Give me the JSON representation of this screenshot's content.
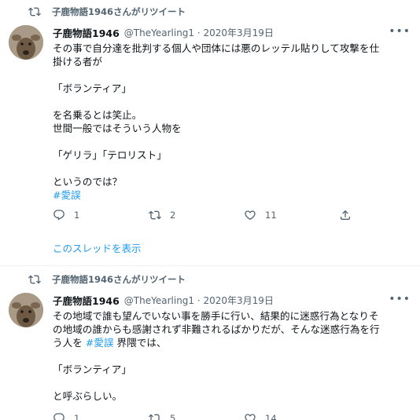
{
  "tweets": [
    {
      "retweet_label": "子鹿物語1946さんがリツイート",
      "author_name": "子鹿物語1946",
      "author_meta": "@TheYearling1 · 2020年3月19日",
      "more_label": "•••",
      "text_lines": [
        "その事で自分達を批判する個人や団体には悪のレッテル貼りして攻撃を仕",
        "掛ける者が",
        "",
        "「ボランティア」",
        "",
        "を名乗るとは笑止。",
        "世間一般ではそういう人物を",
        "",
        "「ゲリラ」「テロリスト」",
        "",
        "というのでは？"
      ],
      "hashtag": "#愛誤",
      "reply_count": "1",
      "retweet_count": "2",
      "like_count": "11",
      "show_thread": "このスレッドを表示"
    },
    {
      "retweet_label": "子鹿物語1946さんがリツイート",
      "author_name": "子鹿物語1946",
      "author_meta": "@TheYearling1 · 2020年3月19日",
      "more_label": "•••",
      "text_lines": [
        "その地域で誰も望んでいない事を勝手に行い、結果的に迷惑行為となりそ",
        "の地域の誰からも感謝されず非難されるばかりだが、そんな迷惑行為を行"
      ],
      "line3_before": "う人を ",
      "hashtag": "#愛誤",
      "line3_after": " 界隈では、",
      "text_lines_after": [
        "",
        "「ボランティア」",
        "",
        "と呼ぶらしい。"
      ],
      "reply_count": "1",
      "retweet_count": "5",
      "like_count": "14"
    }
  ]
}
